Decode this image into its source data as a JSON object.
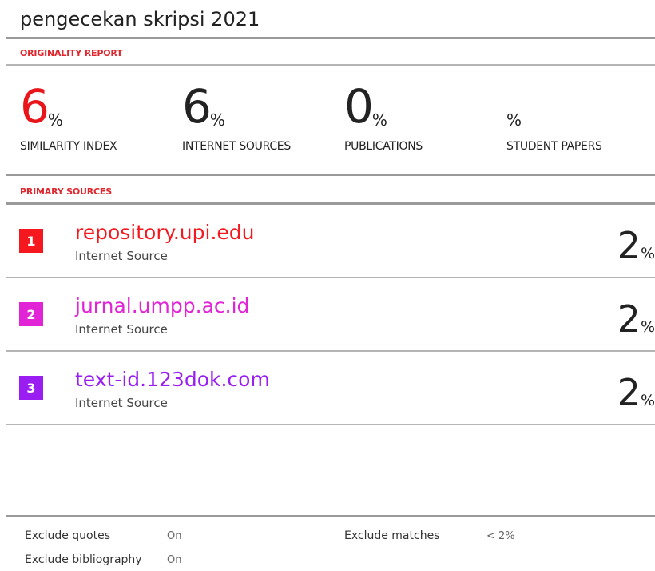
{
  "report": {
    "title": "pengecekan skripsi 2021",
    "originality_label": "ORIGINALITY REPORT",
    "primary_sources_label": "PRIMARY SOURCES"
  },
  "stats": [
    {
      "value": "6",
      "unit": "%",
      "label": "SIMILARITY INDEX",
      "color": "#e8161b"
    },
    {
      "value": "6",
      "unit": "%",
      "label": "INTERNET SOURCES",
      "color": "#222222"
    },
    {
      "value": "0",
      "unit": "%",
      "label": "PUBLICATIONS",
      "color": "#222222"
    },
    {
      "value": "",
      "unit": "%",
      "label": "STUDENT PAPERS",
      "color": "#222222"
    }
  ],
  "sources": [
    {
      "rank": "1",
      "name": "repository.upi.edu",
      "type": "Internet Source",
      "percent": "2",
      "unit": "%",
      "color": "#f5191f"
    },
    {
      "rank": "2",
      "name": "jurnal.umpp.ac.id",
      "type": "Internet Source",
      "percent": "2",
      "unit": "%",
      "color": "#e124d6"
    },
    {
      "rank": "3",
      "name": "text-id.123dok.com",
      "type": "Internet Source",
      "percent": "2",
      "unit": "%",
      "color": "#9a1ef2"
    }
  ],
  "footer": {
    "exclude_quotes_label": "Exclude quotes",
    "exclude_quotes_value": "On",
    "exclude_bibliography_label": "Exclude bibliography",
    "exclude_bibliography_value": "On",
    "exclude_matches_label": "Exclude matches",
    "exclude_matches_value": "< 2%"
  }
}
